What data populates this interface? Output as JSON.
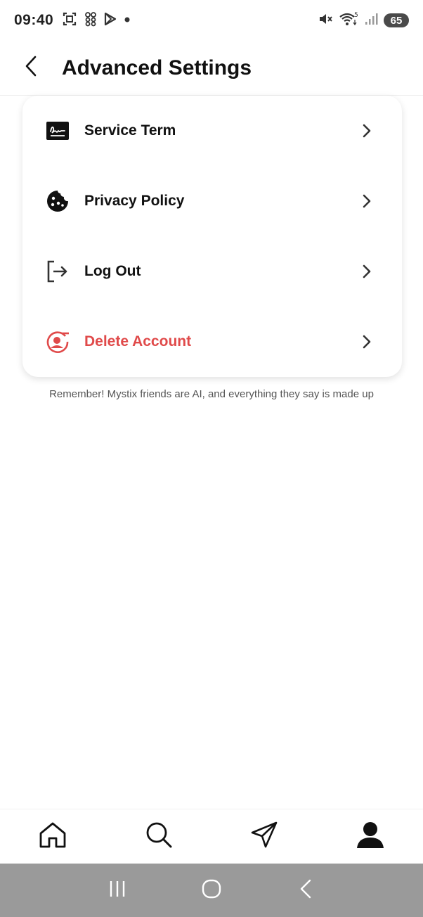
{
  "status_bar": {
    "time": "09:40",
    "battery": "65",
    "icons": [
      "screenshot-icon",
      "qr-icon",
      "play-store-icon",
      "dot-icon",
      "mute-icon",
      "wifi-icon",
      "signal-icon"
    ]
  },
  "header": {
    "title": "Advanced Settings",
    "back_icon": "back-arrow-icon"
  },
  "settings": {
    "items": [
      {
        "label": "Service Term",
        "icon": "signature-icon"
      },
      {
        "label": "Privacy Policy",
        "icon": "cookie-icon"
      },
      {
        "label": "Log Out",
        "icon": "logout-icon"
      },
      {
        "label": "Delete Account",
        "icon": "delete-user-icon",
        "color": "#e04a4a"
      }
    ]
  },
  "disclaimer": "Remember! Mystix friends are AI, and everything they say is made up",
  "tabs": [
    {
      "icon": "home-icon"
    },
    {
      "icon": "search-icon"
    },
    {
      "icon": "send-icon"
    },
    {
      "icon": "profile-icon",
      "active": true
    }
  ],
  "system_nav": [
    "recents-icon",
    "home-circle-icon",
    "back-icon"
  ],
  "colors": {
    "danger": "#e04a4a",
    "nav_bar": "#9a9a9a"
  }
}
